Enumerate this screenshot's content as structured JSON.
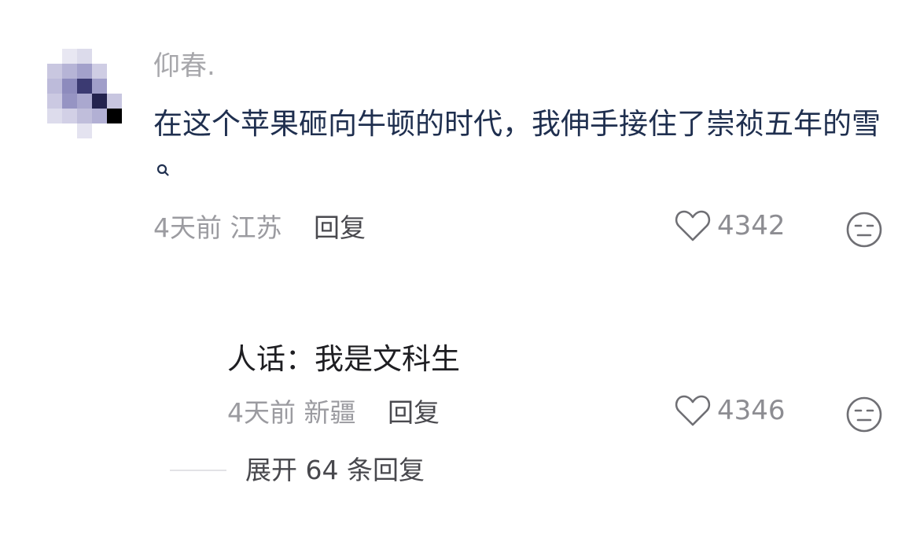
{
  "comment": {
    "username": "仰春.",
    "text": "在这个苹果砸向牛顿的时代，我伸手接住了崇祯五年的雪",
    "search_icon": "search-icon",
    "time": "4天前",
    "location": "江苏",
    "reply_label": "回复",
    "likes": "4342",
    "avatar_colors": [
      "#d6d4e8",
      "#9896c4",
      "#3a3a70",
      "#1c1c44",
      "#000000"
    ]
  },
  "reply": {
    "text": "人话：我是文科生",
    "time": "4天前",
    "location": "新疆",
    "reply_label": "回复",
    "likes": "4346"
  },
  "expand": {
    "label": "展开 64 条回复"
  },
  "icons": {
    "like": "heart-icon",
    "dislike": "neutral-face-icon"
  }
}
